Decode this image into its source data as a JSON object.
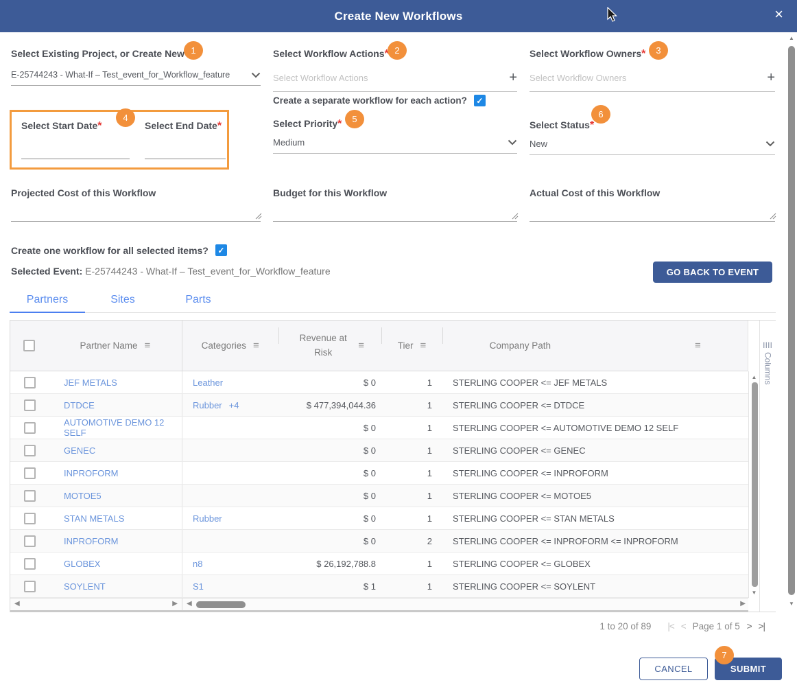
{
  "colors": {
    "header_blue": "#3d5b97",
    "badge_orange": "#f2903b",
    "date_box_orange": "#f39b3e",
    "required_red": "#e53935",
    "link_blue": "#6b95dc",
    "tab_blue": "#5b8def",
    "checkbox_blue": "#1e88e5"
  },
  "header": {
    "title": "Create New Workflows"
  },
  "icons": {
    "close": "×",
    "plus": "+",
    "menu": "≡",
    "check": "✓",
    "scroll_up": "▲",
    "scroll_down": "▼",
    "scroll_left": "◀",
    "scroll_right": "▶",
    "first_page": "|<",
    "prev_page": "<",
    "next_page": ">",
    "last_page": ">|",
    "columns_bars": "||||"
  },
  "form": {
    "project": {
      "label": "Select Existing Project, or Create New",
      "required": "*",
      "badge": "1",
      "value": "E-25744243 - What-If – Test_event_for_Workflow_feature"
    },
    "actions": {
      "label": "Select Workflow Actions",
      "required": "*",
      "badge": "2",
      "placeholder": "Select Workflow Actions"
    },
    "owners": {
      "label": "Select Workflow Owners",
      "required": "*",
      "badge": "3",
      "placeholder": "Select Workflow Owners"
    },
    "separate_workflow": {
      "label": "Create a separate workflow for each action?",
      "checked": true
    },
    "dates": {
      "badge": "4",
      "start_label": "Select Start Date",
      "end_label": "Select End Date",
      "required": "*"
    },
    "priority": {
      "label": "Select Priority",
      "required": "*",
      "badge": "5",
      "value": "Medium"
    },
    "status": {
      "label": "Select Status",
      "required": "*",
      "badge": "6",
      "value": "New"
    },
    "projected_cost": {
      "label": "Projected Cost of this Workflow",
      "value": ""
    },
    "budget": {
      "label": "Budget for this Workflow",
      "value": ""
    },
    "actual_cost": {
      "label": "Actual Cost of this Workflow",
      "value": ""
    },
    "one_workflow": {
      "label": "Create one workflow for all selected items?",
      "checked": true
    },
    "selected_event": {
      "label": "Selected Event:",
      "value": " E-25744243 - What-If – Test_event_for_Workflow_feature"
    },
    "go_back_button": "GO BACK TO EVENT"
  },
  "tabs": [
    {
      "label": "Partners",
      "active": true
    },
    {
      "label": "Sites",
      "active": false
    },
    {
      "label": "Parts",
      "active": false
    }
  ],
  "table": {
    "headers": {
      "partner": "Partner Name",
      "categories": "Categories",
      "revenue": "Revenue at Risk",
      "tier": "Tier",
      "path": "Company Path"
    },
    "columns_panel": "Columns",
    "rows": [
      {
        "partner": "JEF METALS",
        "categories": "Leather",
        "more": "",
        "revenue": "$ 0",
        "tier": "1",
        "path": "STERLING COOPER <= JEF METALS"
      },
      {
        "partner": "DTDCE",
        "categories": "Rubber",
        "more": "+4",
        "revenue": "$ 477,394,044.36",
        "tier": "1",
        "path": "STERLING COOPER <= DTDCE"
      },
      {
        "partner": "AUTOMOTIVE DEMO 12 SELF",
        "categories": "",
        "more": "",
        "revenue": "$ 0",
        "tier": "1",
        "path": "STERLING COOPER <= AUTOMOTIVE DEMO 12 SELF"
      },
      {
        "partner": "GENEC",
        "categories": "",
        "more": "",
        "revenue": "$ 0",
        "tier": "1",
        "path": "STERLING COOPER <= GENEC"
      },
      {
        "partner": "INPROFORM",
        "categories": "",
        "more": "",
        "revenue": "$ 0",
        "tier": "1",
        "path": "STERLING COOPER <= INPROFORM"
      },
      {
        "partner": "MOTOE5",
        "categories": "",
        "more": "",
        "revenue": "$ 0",
        "tier": "1",
        "path": "STERLING COOPER <= MOTOE5"
      },
      {
        "partner": "STAN METALS",
        "categories": "Rubber",
        "more": "",
        "revenue": "$ 0",
        "tier": "1",
        "path": "STERLING COOPER <= STAN METALS"
      },
      {
        "partner": "INPROFORM",
        "categories": "",
        "more": "",
        "revenue": "$ 0",
        "tier": "2",
        "path": "STERLING COOPER <= INPROFORM <= INPROFORM"
      },
      {
        "partner": "GLOBEX",
        "categories": "n8",
        "more": "",
        "revenue": "$ 26,192,788.8",
        "tier": "1",
        "path": "STERLING COOPER <= GLOBEX"
      },
      {
        "partner": "SOYLENT",
        "categories": "S1",
        "more": "",
        "revenue": "$ 1",
        "tier": "1",
        "path": "STERLING COOPER <= SOYLENT"
      }
    ]
  },
  "pagination": {
    "range": "1 to 20 of 89",
    "page": "Page 1 of 5"
  },
  "footer": {
    "cancel": "CANCEL",
    "submit": "SUBMIT",
    "submit_badge": "7"
  }
}
